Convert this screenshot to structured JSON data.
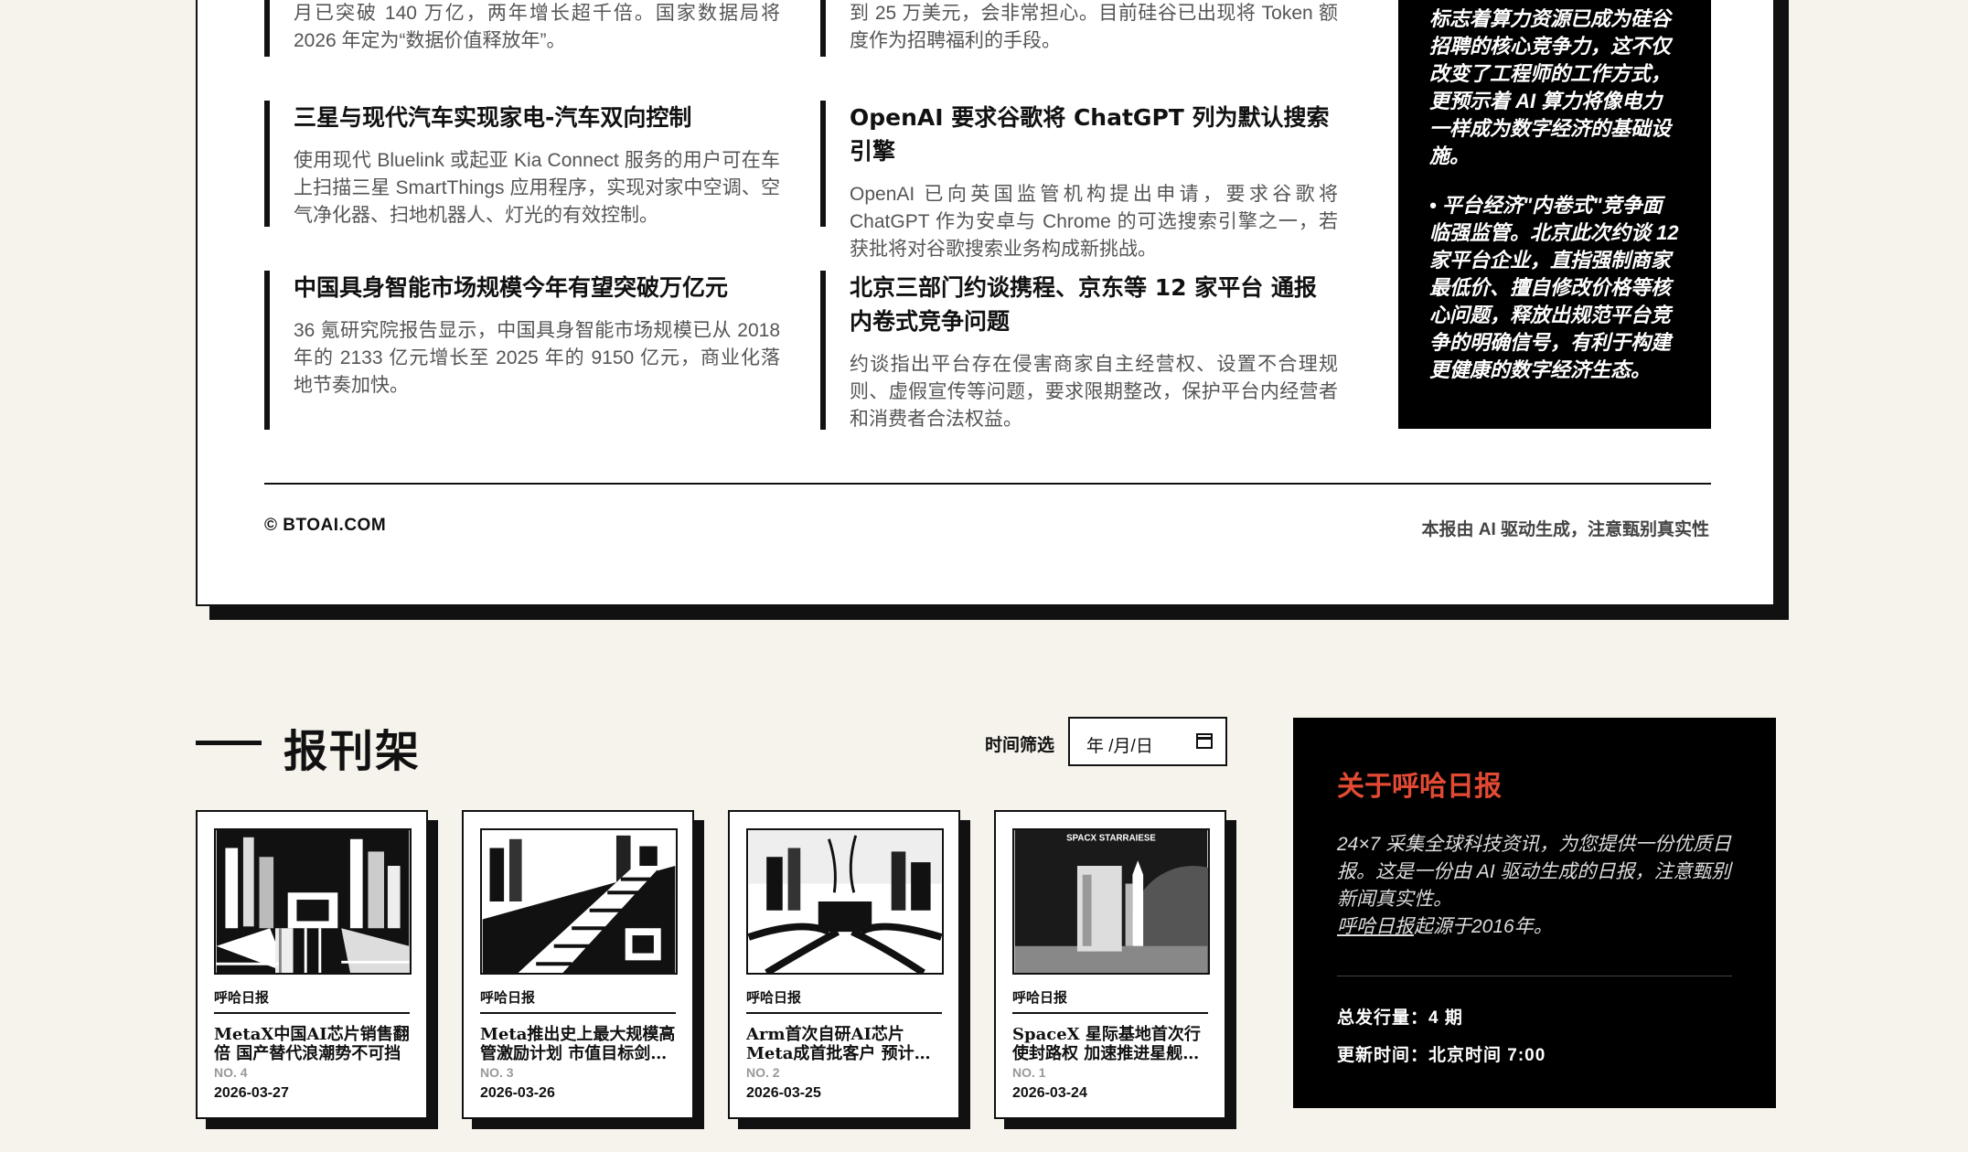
{
  "news": {
    "top_left_tail": "月已突破 140 万亿，两年增长超千倍。国家数据局将 2026 年定为“数据价值释放年”。",
    "top_mid_tail": "到 25 万美元，会非常担心。目前硅谷已出现将 Token 额度作为招聘福利的手段。",
    "items": [
      {
        "title": "三星与现代汽车实现家电-汽车双向控制",
        "body": "使用现代 Bluelink 或起亚 Kia Connect 服务的用户可在车上扫描三星 SmartThings 应用程序，实现对家中空调、空气净化器、扫地机器人、灯光的有效控制。"
      },
      {
        "title": "OpenAI 要求谷歌将 ChatGPT 列为默认搜索引擎",
        "body": "OpenAI 已向英国监管机构提出申请，要求谷歌将 ChatGPT 作为安卓与 Chrome 的可选搜索引擎之一，若获批将对谷歌搜索业务构成新挑战。"
      },
      {
        "title": "中国具身智能市场规模今年有望突破万亿元",
        "body": "36 氪研究院报告显示，中国具身智能市场规模已从 2018 年的 2133 亿元增长至 2025 年的 9150 亿元，商业化落地节奏加快。"
      },
      {
        "title": "北京三部门约谈携程、京东等 12 家平台 通报内卷式竞争问题",
        "body": "约谈指出平台存在侵害商家自主经营权、设置不合理规则、虚假宣传等问题，要求限期整改，保护平台内经营者和消费者合法权益。"
      }
    ]
  },
  "sidebox": {
    "para1_tail": "标志着算力资源已成为硅谷招聘的核心竞争力，这不仅改变了工程师的工作方式，更预示着 AI 算力将像电力一样成为数字经济的基础设施。",
    "para2": "• 平台经济\"内卷式\"竞争面临强监管。北京此次约谈 12 家平台企业，直指强制商家最低价、擅自修改价格等核心问题，释放出规范平台竞争的明确信号，有利于构建更健康的数字经济生态。"
  },
  "footer": {
    "copyright": "© BTOAI.COM",
    "disclaimer": "本报由 AI 驱动生成，注意甄别真实性"
  },
  "shelf": {
    "title": "报刊架",
    "filter_label": "时间筛选",
    "date_placeholder": "年 /月/日",
    "cards": [
      {
        "publisher": "呼哈日报",
        "title": "MetaX中国AI芯片销售翻倍 国产替代浪潮势不可挡",
        "no": "NO. 4",
        "date": "2026-03-27"
      },
      {
        "publisher": "呼哈日报",
        "title": "Meta推出史上最大规模高管激励计划 市值目标剑指…",
        "no": "NO. 3",
        "date": "2026-03-26"
      },
      {
        "publisher": "呼哈日报",
        "title": "Arm首次自研AI芯片 Meta成首批客户 预计5…",
        "no": "NO. 2",
        "date": "2026-03-25"
      },
      {
        "publisher": "呼哈日报",
        "title": "SpaceX 星际基地首次行使封路权 加速推进星舰…",
        "no": "NO. 1",
        "date": "2026-03-24"
      }
    ],
    "cover4_sign": "SPACX STARRAIESE"
  },
  "about": {
    "title": "关于呼哈日报",
    "desc": "24×7 采集全球科技资讯，为您提供一份优质日报。这是一份由 AI 驱动生成的日报，注意甄别新闻真实性。",
    "link_text": "呼哈日报",
    "since_text": "起源于2016年。",
    "issues": "总发行量：4 期",
    "updated": "更新时间：北京时间 7:00"
  }
}
